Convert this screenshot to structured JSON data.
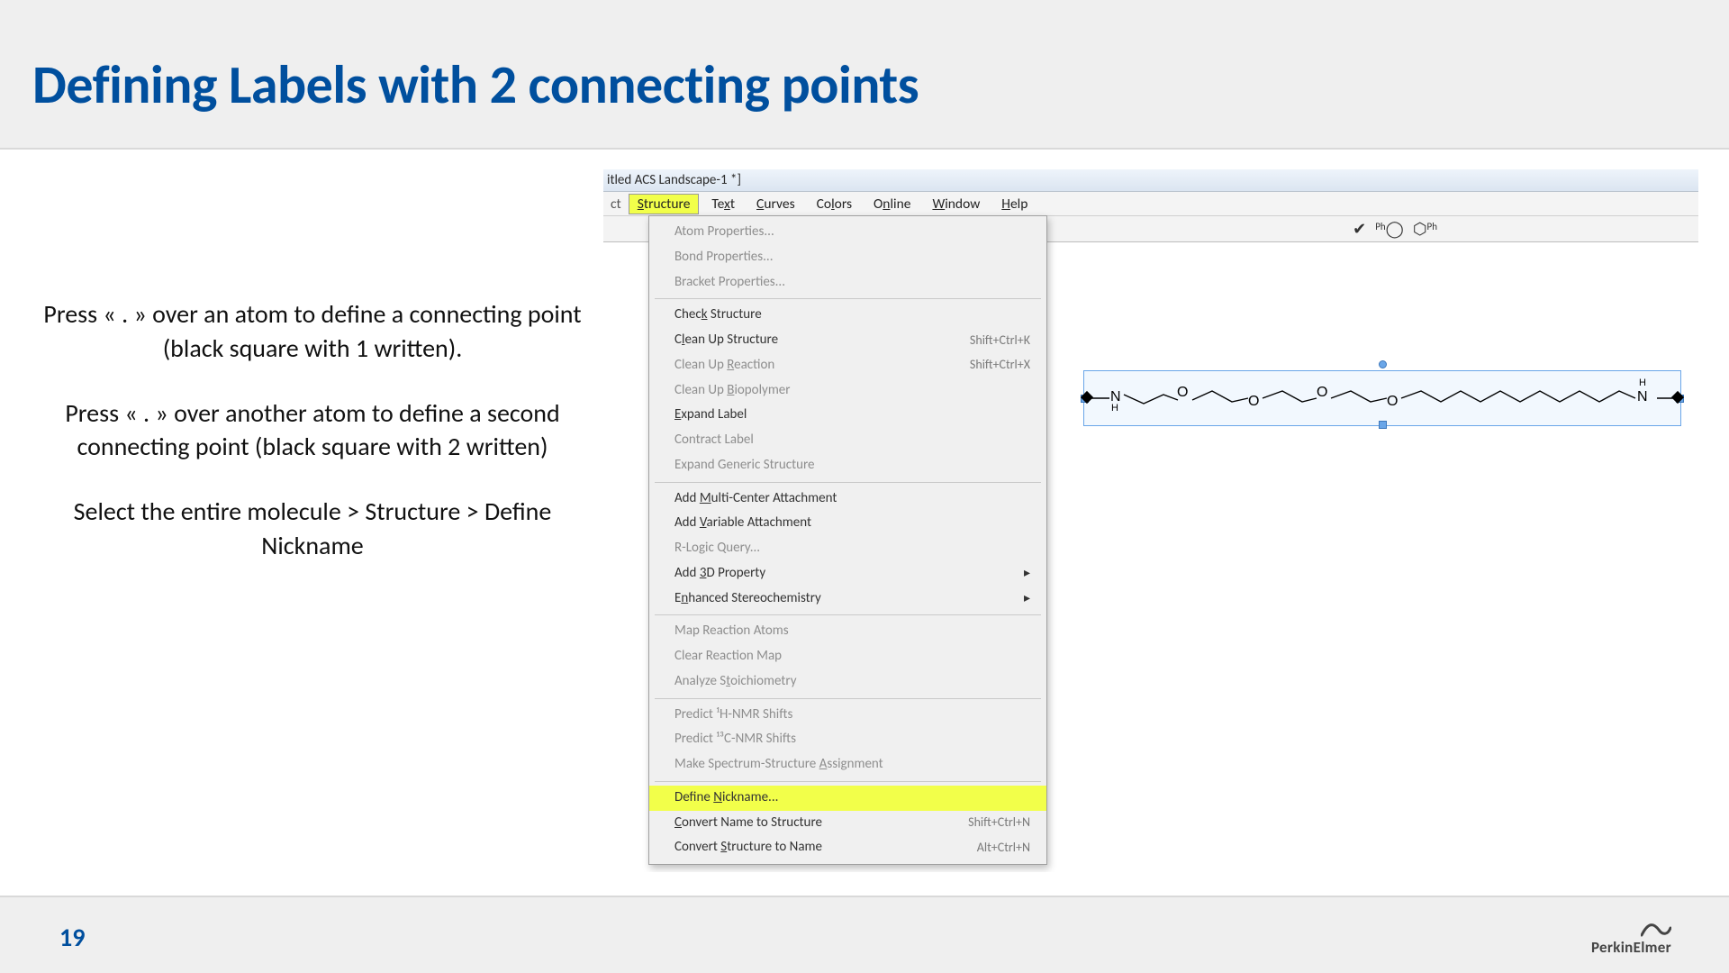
{
  "slide": {
    "title": "Defining Labels with 2 connecting points",
    "page_number": "19",
    "brand": "PerkinElmer",
    "para1": "Press « . » over an atom to define a connecting point (black square with 1 written).",
    "para2": "Press « . » over another atom to define a second connecting point (black square with 2 written)",
    "para3": "Select the entire molecule > Structure > Define Nickname"
  },
  "app": {
    "title_fragment": "itled ACS Landscape-1 *]",
    "menubar_left_fragment": "ct",
    "menus": {
      "structure": "Structure",
      "text": "Text",
      "curves": "Curves",
      "colors": "Colors",
      "online": "Online",
      "window": "Window",
      "help": "Help"
    }
  },
  "dropdown": {
    "atom_props": "Atom Properties...",
    "bond_props": "Bond Properties...",
    "bracket_props": "Bracket Properties...",
    "check_structure": "Check Structure",
    "clean_up_structure": "Clean Up Structure",
    "clean_up_structure_sc": "Shift+Ctrl+K",
    "clean_up_reaction": "Clean Up Reaction",
    "clean_up_reaction_sc": "Shift+Ctrl+X",
    "clean_up_biopolymer": "Clean Up Biopolymer",
    "expand_label": "Expand Label",
    "contract_label": "Contract Label",
    "expand_generic": "Expand Generic Structure",
    "add_multi_center": "Add Multi-Center Attachment",
    "add_variable": "Add Variable Attachment",
    "r_logic": "R-Logic Query...",
    "add_3d": "Add 3D Property",
    "enhanced_stereo": "Enhanced Stereochemistry",
    "map_reaction_atoms": "Map Reaction Atoms",
    "clear_reaction_map": "Clear Reaction Map",
    "analyze_stoich": "Analyze Stoichiometry",
    "predict_1h": "Predict ¹H-NMR Shifts",
    "predict_13c": "Predict ¹³C-NMR Shifts",
    "make_spectrum": "Make Spectrum-Structure Assignment",
    "define_nickname": "Define Nickname...",
    "convert_nts": "Convert Name to Structure",
    "convert_nts_sc": "Shift+Ctrl+N",
    "convert_stn": "Convert Structure to Name",
    "convert_stn_sc": "Alt+Ctrl+N"
  },
  "molecule": {
    "left_n": "N",
    "left_h": "H",
    "o": "O",
    "right_n": "N",
    "right_h_top": "H",
    "right_h_bot": ""
  }
}
